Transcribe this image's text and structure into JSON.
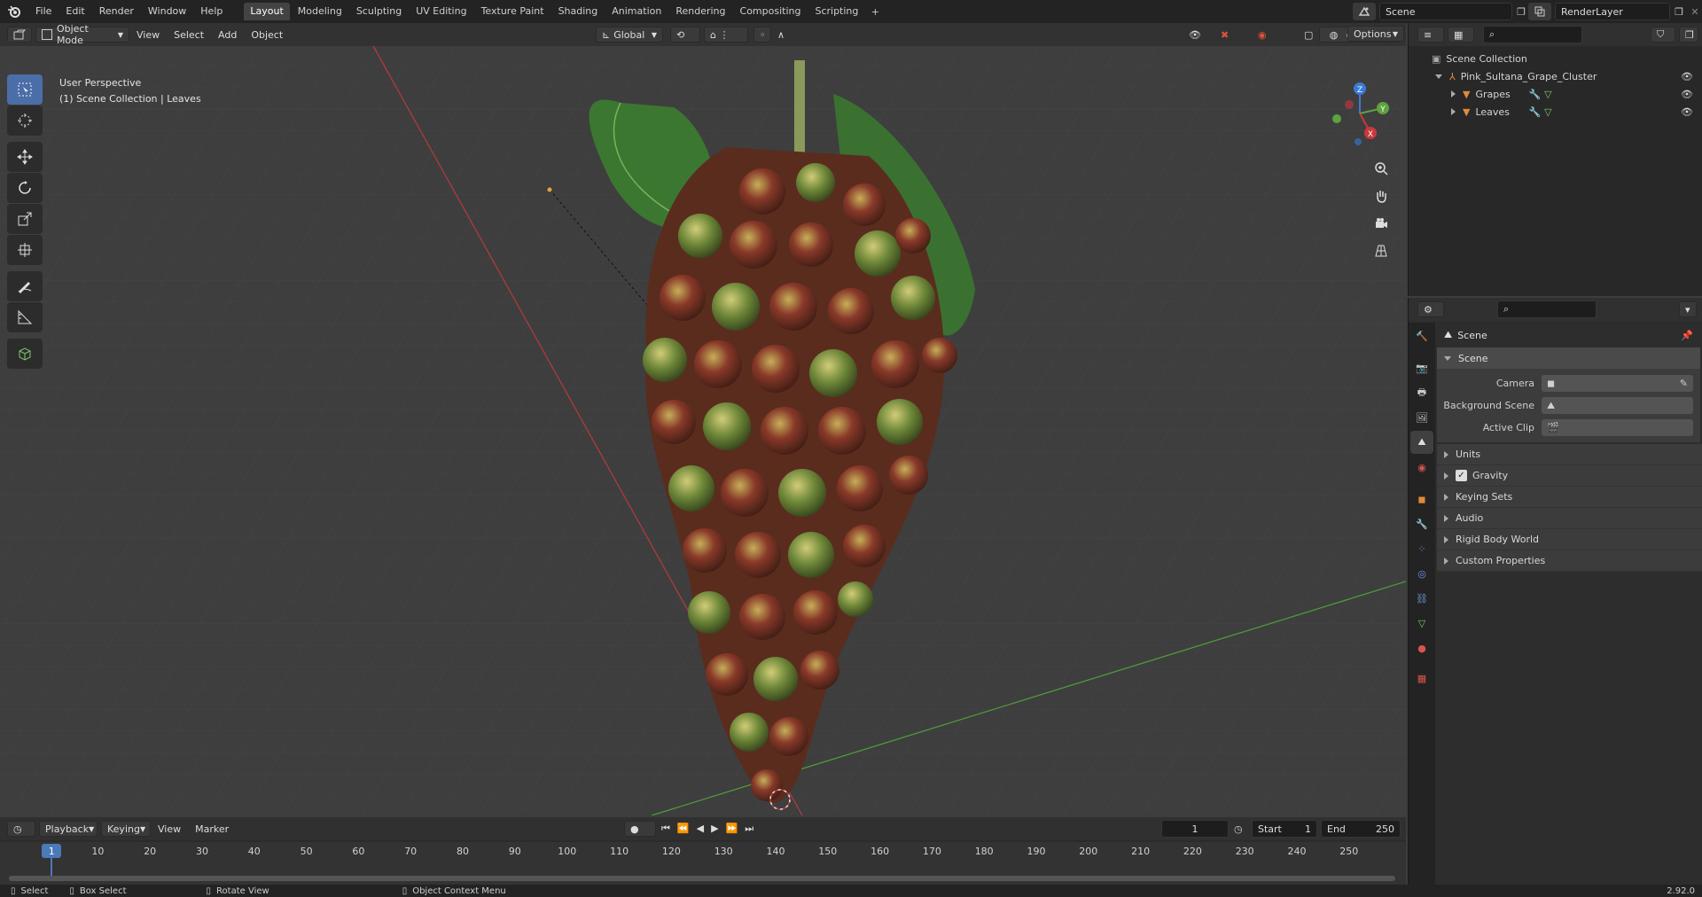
{
  "top_menu": [
    "File",
    "Edit",
    "Render",
    "Window",
    "Help"
  ],
  "workspace_tabs": [
    "Layout",
    "Modeling",
    "Sculpting",
    "UV Editing",
    "Texture Paint",
    "Shading",
    "Animation",
    "Rendering",
    "Compositing",
    "Scripting"
  ],
  "scene_name": "Scene",
  "render_layer": "RenderLayer",
  "viewport": {
    "mode": "Object Mode",
    "menus": [
      "View",
      "Select",
      "Add",
      "Object"
    ],
    "transform_orientation": "Global",
    "options_label": "Options",
    "info_line1": "User Perspective",
    "info_line2": "(1) Scene Collection | Leaves"
  },
  "gizmo": {
    "z": "Z",
    "y": "Y",
    "x": "X"
  },
  "outliner": {
    "root": "Scene Collection",
    "collection": "Pink_Sultana_Grape_Cluster",
    "children": [
      "Grapes",
      "Leaves"
    ]
  },
  "properties": {
    "context": "Scene",
    "panel_title": "Scene",
    "rows": [
      {
        "label": "Camera"
      },
      {
        "label": "Background Scene"
      },
      {
        "label": "Active Clip"
      }
    ],
    "sub_panels": [
      "Units",
      "Gravity",
      "Keying Sets",
      "Audio",
      "Rigid Body World",
      "Custom Properties"
    ]
  },
  "timeline": {
    "menus": [
      "Playback",
      "Keying",
      "View",
      "Marker"
    ],
    "current_frame": "1",
    "start_label": "Start",
    "start": "1",
    "end_label": "End",
    "end": "250",
    "ticks": [
      "1",
      "10",
      "20",
      "30",
      "40",
      "50",
      "60",
      "70",
      "80",
      "90",
      "100",
      "110",
      "120",
      "130",
      "140",
      "150",
      "160",
      "170",
      "180",
      "190",
      "200",
      "210",
      "220",
      "230",
      "240",
      "250"
    ]
  },
  "status": {
    "select": "Select",
    "box_select": "Box Select",
    "rotate_view": "Rotate View",
    "context_menu": "Object Context Menu",
    "version": "2.92.0"
  },
  "colors": {
    "accent": "#4b6ea8",
    "x_axis": "#c8383d",
    "y_axis": "#5ea33e",
    "z_axis": "#3a7ad6",
    "header": "#232323"
  }
}
